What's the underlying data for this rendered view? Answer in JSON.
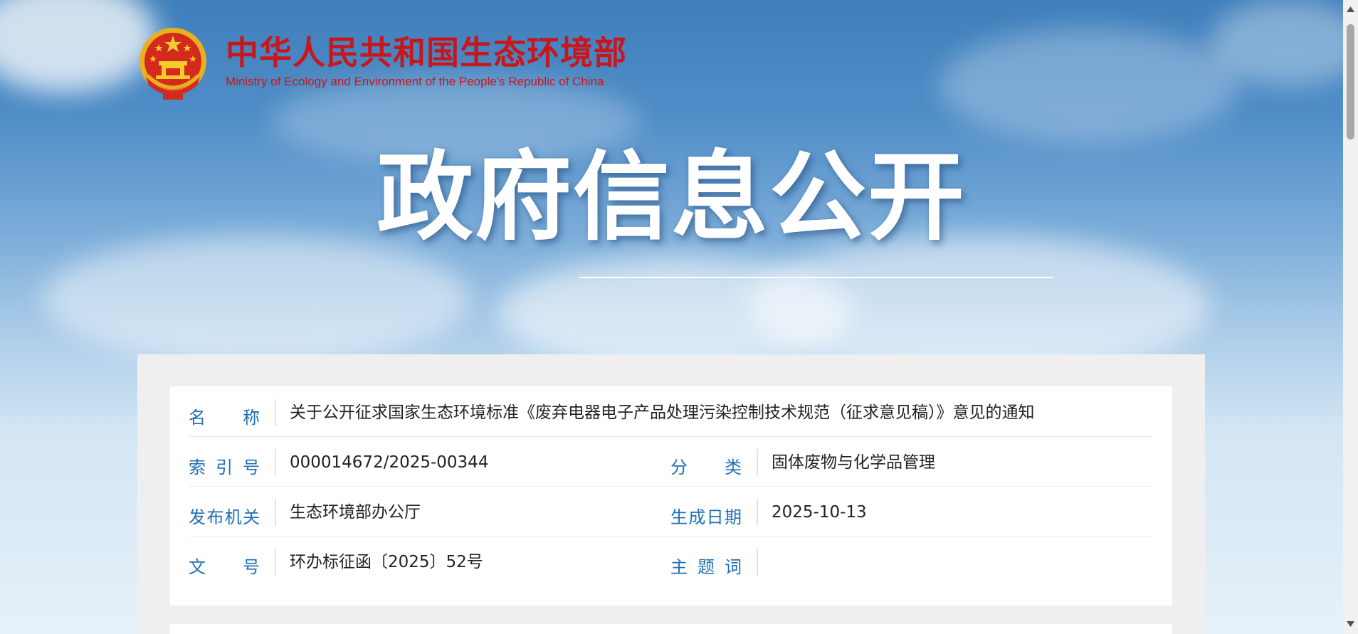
{
  "header": {
    "site_name_cn": "中华人民共和国生态环境部",
    "site_name_en": "Ministry of Ecology and Environment of the People's Republic of China",
    "emblem_icon": "national-emblem-icon"
  },
  "banner": {
    "title": "政府信息公开"
  },
  "info": {
    "name": {
      "label": "名　称",
      "value": "关于公开征求国家生态环境标准《废弃电器电子产品处理污染控制技术规范（征求意见稿）》意见的通知"
    },
    "index_no": {
      "label": "索引号",
      "value": "000014672/2025-00344"
    },
    "category": {
      "label": "分　类",
      "value": "固体废物与化学品管理"
    },
    "issuer": {
      "label": "发布机关",
      "value": "生态环境部办公厅"
    },
    "date": {
      "label": "生成日期",
      "value": "2025-10-13"
    },
    "doc_no": {
      "label": "文　号",
      "value": "环办标征函〔2025〕52号"
    },
    "keywords": {
      "label": "主题词",
      "value": ""
    }
  },
  "colors": {
    "brand_red": "#c8161d",
    "label_blue": "#1f6fb6",
    "text": "#222222"
  }
}
